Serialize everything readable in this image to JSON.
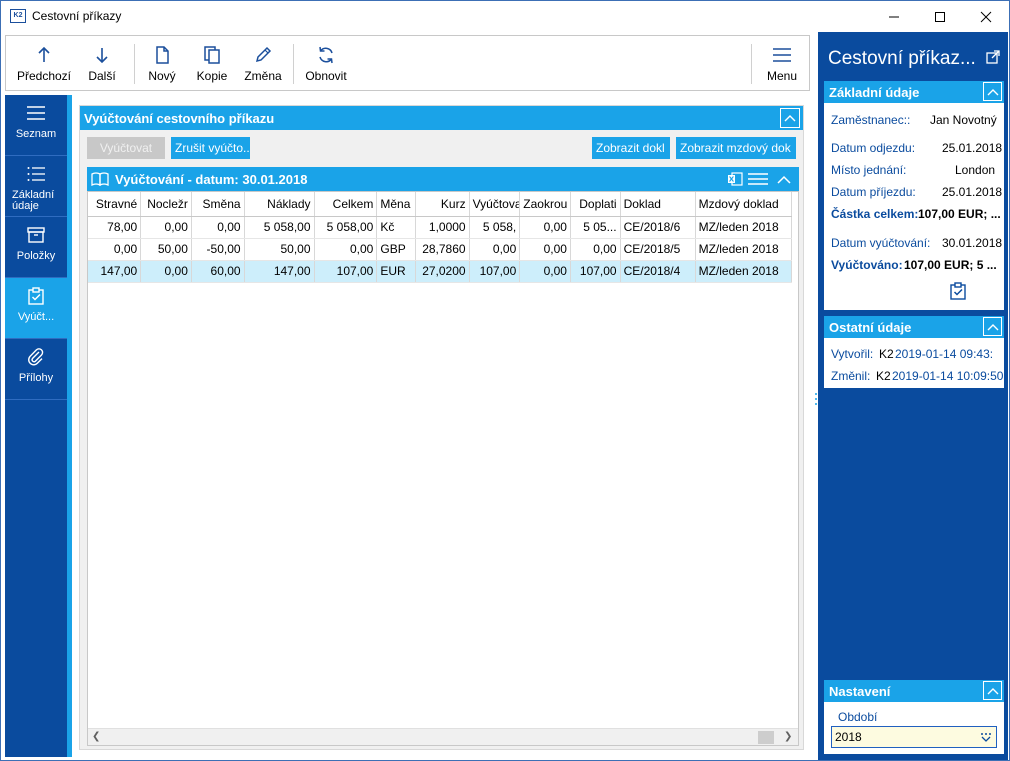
{
  "window": {
    "title": "Cestovní příkazy",
    "app_icon_text": "K2"
  },
  "toolbar": {
    "buttons": [
      {
        "label": "Předchozí",
        "icon": "arrow-up-icon"
      },
      {
        "label": "Další",
        "icon": "arrow-down-icon"
      },
      {
        "label": "Nový",
        "icon": "new-document-icon"
      },
      {
        "label": "Kopie",
        "icon": "copy-icon"
      },
      {
        "label": "Změna",
        "icon": "pencil-icon"
      },
      {
        "label": "Obnovit",
        "icon": "refresh-icon"
      },
      {
        "label": "Menu",
        "icon": "hamburger-menu-icon"
      }
    ]
  },
  "leftnav": {
    "items": [
      {
        "label": "Seznam",
        "icon": "list-lines-icon",
        "active": false
      },
      {
        "label": "Základní údaje",
        "icon": "bullet-list-icon",
        "active": false
      },
      {
        "label": "Položky",
        "icon": "box-icon",
        "active": false
      },
      {
        "label": "Vyúčt...",
        "icon": "clipboard-check-icon",
        "active": true
      },
      {
        "label": "Přílohy",
        "icon": "paperclip-icon",
        "active": false
      }
    ]
  },
  "panel": {
    "title": "Vyúčtování cestovního příkazu",
    "buttons": {
      "vyuctovat": "Vyúčtovat",
      "zrusit": "Zrušit vyúčto...",
      "zobrazit_dokl": "Zobrazit dokl",
      "zobrazit_mzdovy": "Zobrazit mzdový dok"
    },
    "grid": {
      "title": "Vyúčtování - datum: 30.01.2018",
      "columns": [
        "Stravné",
        "Nocležr",
        "Směna",
        "Náklady",
        "Celkem",
        "Měna",
        "Kurz",
        "Vyúčtova",
        "Zaokrou",
        "Doplati",
        "Doklad",
        "Mzdový doklad"
      ],
      "rows": [
        [
          "78,00",
          "0,00",
          "0,00",
          "5 058,00",
          "5 058,00",
          "Kč",
          "1,0000",
          "5 058,",
          "0,00",
          "5 05...",
          "CE/2018/6",
          "MZ/leden 2018"
        ],
        [
          "0,00",
          "50,00",
          "-50,00",
          "50,00",
          "0,00",
          "GBP",
          "28,7860",
          "0,00",
          "0,00",
          "0,00",
          "CE/2018/5",
          "MZ/leden 2018"
        ],
        [
          "147,00",
          "0,00",
          "60,00",
          "147,00",
          "107,00",
          "EUR",
          "27,0200",
          "107,00",
          "0,00",
          "107,00",
          "CE/2018/4",
          "MZ/leden 2018"
        ]
      ],
      "selected_row": 2
    }
  },
  "rightpanel": {
    "title": "Cestovní příkaz...",
    "zakladni": {
      "title": "Základní údaje",
      "zamestnanec_label": "Zaměstnanec::",
      "zamestnanec_value": "Jan Novotný",
      "odjezd_label": "Datum odjezdu:",
      "odjezd_value": "25.01.2018",
      "misto_label": "Místo jednání:",
      "misto_value": "London",
      "prijezd_label": "Datum příjezdu:",
      "prijezd_value": "25.01.2018",
      "castka_label": "Částka celkem:",
      "castka_value": "107,00 EUR; ...",
      "datum_vyuct_label": "Datum vyúčtování:",
      "datum_vyuct_value": "30.01.2018",
      "vyuctovano_label": "Vyúčtováno:",
      "vyuctovano_value": "107,00 EUR; 5 ..."
    },
    "ostatni": {
      "title": "Ostatní údaje",
      "vytvoril_label": "Vytvořil:",
      "vytvoril_user": "K2",
      "vytvoril_ts": "2019-01-14 09:43:",
      "zmenil_label": "Změnil:",
      "zmenil_user": "K2",
      "zmenil_ts": "2019-01-14 10:09:50"
    },
    "nastaveni": {
      "title": "Nastavení",
      "obdobi_label": "Období",
      "obdobi_value": "2018"
    }
  },
  "colors": {
    "accent": "#1aa3e8",
    "nav": "#0a4b9e",
    "selected_row": "#cdeefb"
  }
}
